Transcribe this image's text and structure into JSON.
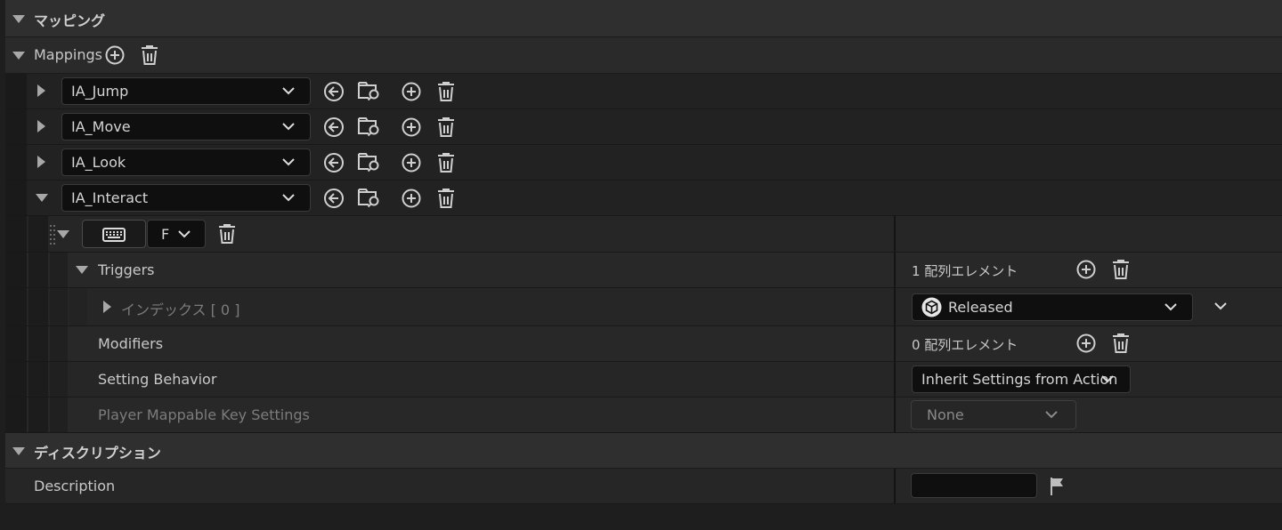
{
  "sections": {
    "mapping_header": "マッピング",
    "description_header": "ディスクリプション"
  },
  "mappings": {
    "label": "Mappings",
    "actions": [
      {
        "name": "IA_Jump",
        "expanded": false
      },
      {
        "name": "IA_Move",
        "expanded": false
      },
      {
        "name": "IA_Look",
        "expanded": false
      },
      {
        "name": "IA_Interact",
        "expanded": true
      }
    ],
    "key_binding": {
      "key": "F",
      "device_icon": "keyboard-icon"
    },
    "triggers": {
      "label": "Triggers",
      "count_text": "1 配列エレメント",
      "index_label": "インデックス [ 0 ]",
      "selected": "Released"
    },
    "modifiers": {
      "label": "Modifiers",
      "count_text": "0 配列エレメント"
    },
    "setting_behavior": {
      "label": "Setting Behavior",
      "value": "Inherit Settings from Action"
    },
    "player_mappable": {
      "label": "Player Mappable Key Settings",
      "value": "None"
    }
  },
  "description": {
    "label": "Description",
    "value": ""
  },
  "colors": {
    "background": "#1e1e1e",
    "section": "#2f2f2f",
    "input": "#0f0f0f",
    "text": "#c8c8c8"
  }
}
